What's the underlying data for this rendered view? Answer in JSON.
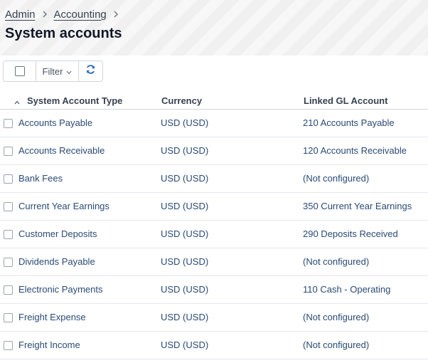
{
  "breadcrumb": {
    "items": [
      "Admin",
      "Accounting"
    ]
  },
  "page": {
    "title": "System accounts"
  },
  "toolbar": {
    "filter_label": "Filter"
  },
  "table": {
    "columns": [
      "System Account Type",
      "Currency",
      "Linked GL Account"
    ],
    "rows": [
      {
        "type": "Accounts Payable",
        "currency": "USD (USD)",
        "gl": "210 Accounts Payable"
      },
      {
        "type": "Accounts Receivable",
        "currency": "USD (USD)",
        "gl": "120 Accounts Receivable"
      },
      {
        "type": "Bank Fees",
        "currency": "USD (USD)",
        "gl": "(Not configured)"
      },
      {
        "type": "Current Year Earnings",
        "currency": "USD (USD)",
        "gl": "350 Current Year Earnings"
      },
      {
        "type": "Customer Deposits",
        "currency": "USD (USD)",
        "gl": "290 Deposits Received"
      },
      {
        "type": "Dividends Payable",
        "currency": "USD (USD)",
        "gl": "(Not configured)"
      },
      {
        "type": "Electronic Payments",
        "currency": "USD (USD)",
        "gl": "110 Cash - Operating"
      },
      {
        "type": "Freight Expense",
        "currency": "USD (USD)",
        "gl": "(Not configured)"
      },
      {
        "type": "Freight Income",
        "currency": "USD (USD)",
        "gl": "(Not configured)"
      }
    ]
  },
  "colors": {
    "link_text": "#2a4a75",
    "header_bg": "#f7f7f7",
    "refresh_icon": "#2b6cb0"
  },
  "icons": {
    "sort": "chevron-up-icon",
    "filter": "chevron-down-icon",
    "refresh": "refresh-icon",
    "breadcrumb_separator": "chevron-right-icon"
  }
}
